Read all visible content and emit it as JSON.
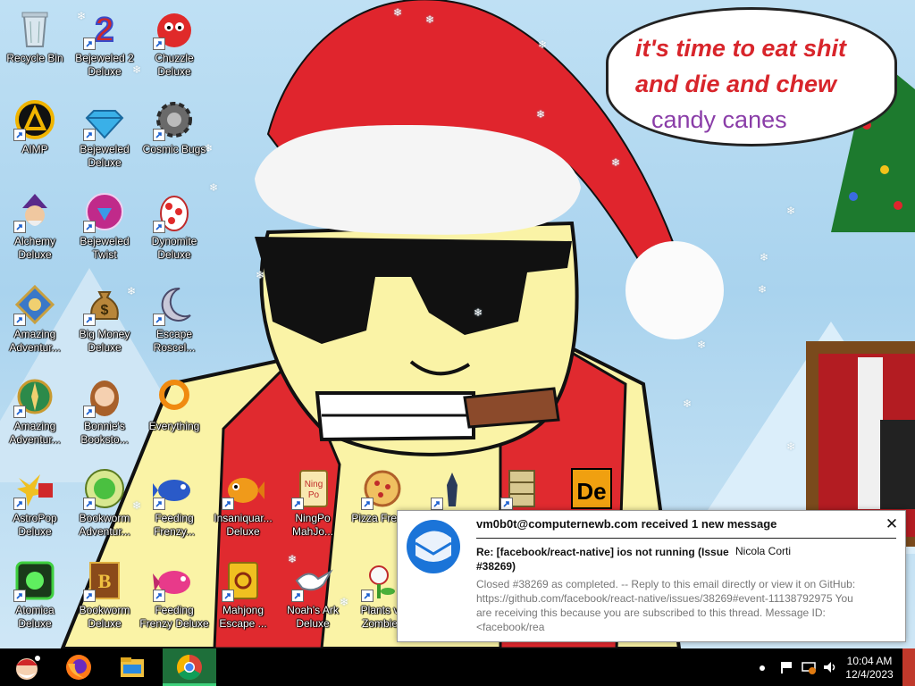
{
  "wallpaper": {
    "speech_lines": [
      "it's time to eat shit",
      "and die and chew",
      "candy canes"
    ]
  },
  "desktop_icons": [
    {
      "label": "Recycle Bin",
      "icon": "recycle-bin-icon",
      "shortcut": false
    },
    {
      "label": "Bejeweled 2 Deluxe",
      "icon": "bejeweled-2-icon",
      "shortcut": true
    },
    {
      "label": "Chuzzle Deluxe",
      "icon": "chuzzle-icon",
      "shortcut": true
    },
    {
      "label": "AIMP",
      "icon": "aimp-icon",
      "shortcut": true
    },
    {
      "label": "Bejeweled Deluxe",
      "icon": "bejeweled-icon",
      "shortcut": true
    },
    {
      "label": "Cosmic Bugs",
      "icon": "cosmic-bugs-icon",
      "shortcut": true
    },
    {
      "label": "Alchemy Deluxe",
      "icon": "alchemy-icon",
      "shortcut": true
    },
    {
      "label": "Bejeweled Twist",
      "icon": "bejeweled-twist-icon",
      "shortcut": true
    },
    {
      "label": "Dynomite Deluxe",
      "icon": "dynomite-icon",
      "shortcut": true
    },
    {
      "label": "Amazing Adventur...",
      "icon": "amazing-adventures-icon",
      "shortcut": true
    },
    {
      "label": "Big Money Deluxe",
      "icon": "big-money-icon",
      "shortcut": true
    },
    {
      "label": "Escape Roscel...",
      "icon": "escape-rosecliff-icon",
      "shortcut": true
    },
    {
      "label": "Amazing Adventur...",
      "icon": "amazing-adventures-2-icon",
      "shortcut": true
    },
    {
      "label": "Bonnie's Booksto...",
      "icon": "bonnies-bookstore-icon",
      "shortcut": true
    },
    {
      "label": "Everything",
      "icon": "everything-search-icon",
      "shortcut": false
    },
    {
      "label": "AstroPop Deluxe",
      "icon": "astropop-icon",
      "shortcut": true
    },
    {
      "label": "Bookworm Adventur...",
      "icon": "bookworm-adventures-icon",
      "shortcut": true
    },
    {
      "label": "Feeding Frenzy...",
      "icon": "feeding-frenzy-icon",
      "shortcut": true
    },
    {
      "label": "Insaniquar... Deluxe",
      "icon": "insaniquarium-icon",
      "shortcut": true
    },
    {
      "label": "NingPo MahJo...",
      "icon": "ningpo-mahjong-icon",
      "shortcut": true
    },
    {
      "label": "Pizza Frenzy",
      "icon": "pizza-frenzy-icon",
      "shortcut": true
    },
    {
      "label": "",
      "icon": "game-shortcut-icon",
      "shortcut": true
    },
    {
      "label": "",
      "icon": "file-cabinet-icon",
      "shortcut": true
    },
    {
      "label": "",
      "icon": "dynomite-de-icon",
      "shortcut": false
    },
    {
      "label": "Atomica Deluxe",
      "icon": "atomica-icon",
      "shortcut": true
    },
    {
      "label": "Bookworm Deluxe",
      "icon": "bookworm-icon",
      "shortcut": true
    },
    {
      "label": "Feeding Frenzy Deluxe",
      "icon": "feeding-frenzy-2-icon",
      "shortcut": true
    },
    {
      "label": "Mahjong Escape ...",
      "icon": "mahjong-escape-icon",
      "shortcut": true
    },
    {
      "label": "Noah's Ark Deluxe",
      "icon": "noahs-ark-icon",
      "shortcut": true
    },
    {
      "label": "Plants vs Zombies",
      "icon": "plants-vs-zombies-icon",
      "shortcut": true
    }
  ],
  "notification": {
    "title": "vm0b0t@computernewb.com received 1 new message",
    "subject": "Re: [facebook/react-native] ios not running (Issue #38269)",
    "sender": "Nicola Corti",
    "body": "Closed #38269 as completed. -- Reply to this email directly or view it on GitHub: https://github.com/facebook/react-native/issues/38269#event-11138792975 You are receiving this because you are subscribed to this thread. Message ID: <facebook/rea",
    "close_icon": "close-icon",
    "app_icon": "thunderbird-icon"
  },
  "taskbar": {
    "start_icon": "santa-start-icon",
    "pinned": [
      {
        "name": "firefox-icon",
        "active": false
      },
      {
        "name": "file-explorer-icon",
        "active": false
      },
      {
        "name": "chrome-icon",
        "active": true
      }
    ],
    "clock_time": "10:04 AM",
    "clock_date": "12/4/2023"
  }
}
